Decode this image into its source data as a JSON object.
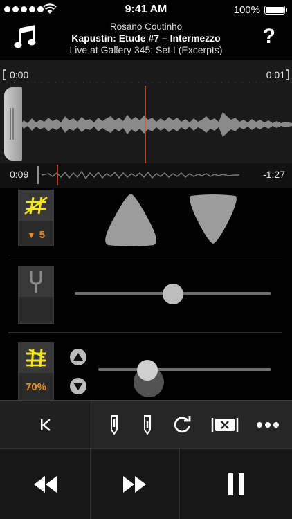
{
  "status_bar": {
    "time": "9:41 AM",
    "battery_percent": "100%",
    "signal_bars": 5
  },
  "header": {
    "artist": "Rosano Coutinho",
    "track_title": "Kapustin: Etude #7 – Intermezzo",
    "album": "Live at Gallery 345: Set I (Excerpts)",
    "help_label": "?",
    "music_icon": "music-note-icon"
  },
  "waveform": {
    "selection_start": "0:00",
    "selection_end": "0:01",
    "current_position": "0:09",
    "remaining_time": "-1:27",
    "playhead_color": "#e0542a"
  },
  "pitch": {
    "icon": "pitch-transpose-icon",
    "value": "5",
    "value_prefix": "▼",
    "up_icon": "pitch-up-triangle-icon",
    "down_icon": "pitch-down-triangle-icon"
  },
  "tuning": {
    "icon": "tuning-fork-icon",
    "level": 0.5
  },
  "speed": {
    "icon": "speed-icon",
    "value": "70%",
    "level": 0.28
  },
  "toolbar": {
    "items": [
      "skip-to-start-icon",
      "set-start-marker-icon",
      "set-end-marker-icon",
      "loop-icon",
      "clear-loop-icon",
      "more-icon"
    ]
  },
  "transport": {
    "items": [
      "rewind-icon",
      "fast-forward-icon",
      "pause-icon"
    ]
  },
  "colors": {
    "accent_orange": "#f08a1c",
    "icon_yellow": "#f2e51c",
    "background": "#000000",
    "panel": "#1a1a1a"
  }
}
